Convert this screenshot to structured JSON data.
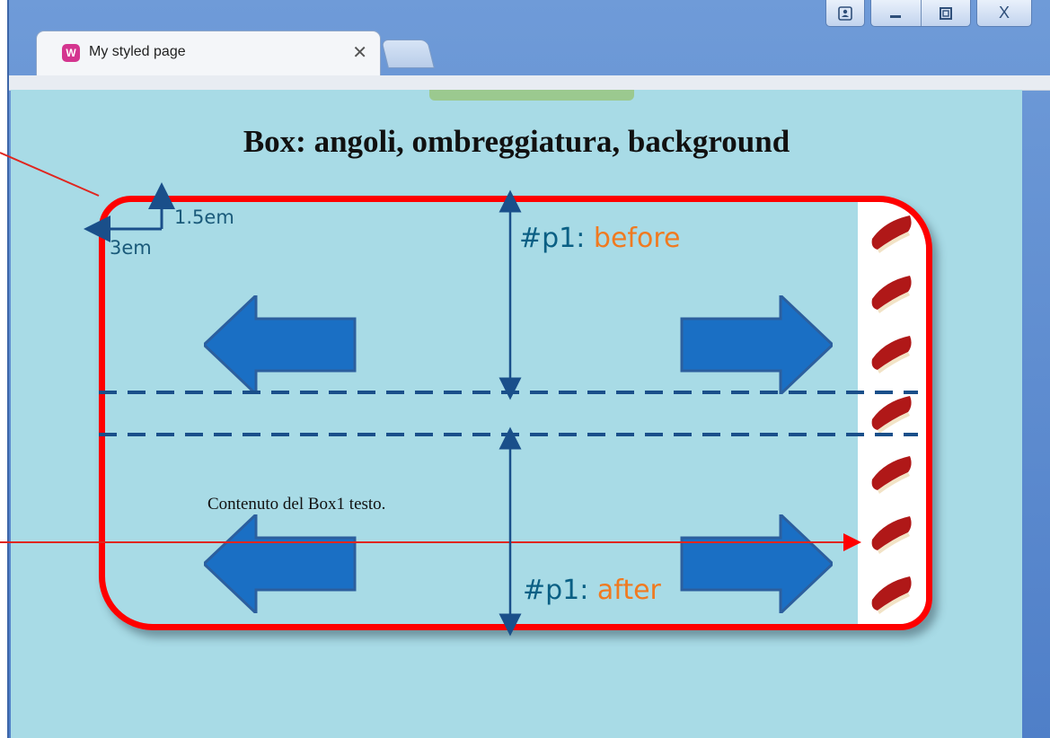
{
  "browser": {
    "tab_title": "My styled page",
    "tab_icon_letter": "W",
    "tab_close": "✕",
    "window_close": "X"
  },
  "page": {
    "heading": "Box: angoli, ombreggiatura, background",
    "box_text": "Contenuto del Box1 testo."
  },
  "annotations": {
    "radius_vertical": "1.5em",
    "radius_horizontal": "3em",
    "before_id": "#p1: ",
    "before_value": "before",
    "after_id": "#p1: ",
    "after_value": "after"
  },
  "colors": {
    "page_background": "#a8dbe6",
    "box_border": "#ff0000",
    "arrow_fill": "#1a6fc4",
    "annotation_label": "#f07a20",
    "dimension_line": "#1a4f8a"
  },
  "icons": {
    "book": "book-icon",
    "arrow_left": "arrow-left-icon",
    "arrow_right": "arrow-right-icon"
  }
}
